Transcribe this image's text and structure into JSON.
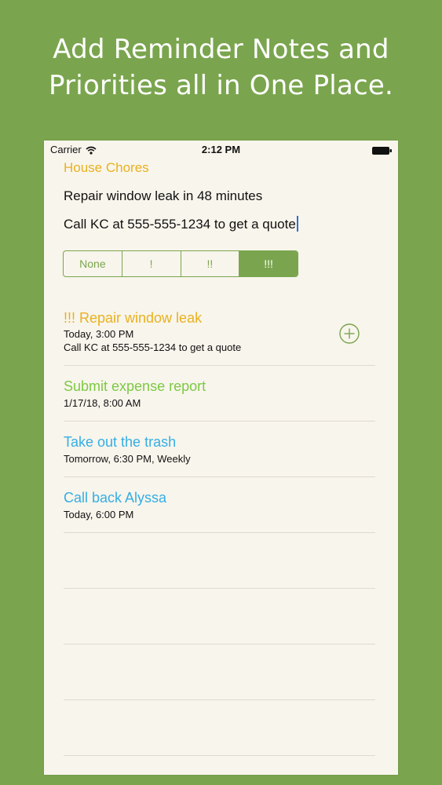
{
  "headline": {
    "line1": "Add Reminder Notes and",
    "line2": "Priorities all in One Place."
  },
  "status_bar": {
    "carrier": "Carrier",
    "time": "2:12 PM"
  },
  "list": {
    "title": "House Chores",
    "title_color": "#e9b11f"
  },
  "editor": {
    "title_value": "Repair window leak in 48 minutes",
    "notes_value": "Call KC at 555-555-1234 to get a quote"
  },
  "priority": {
    "options": [
      "None",
      "!",
      "!!",
      "!!!"
    ],
    "selected": "!!!",
    "accent": "#7aa54e"
  },
  "reminders": [
    {
      "title": "!!! Repair window leak",
      "subtitle": "Today, 3:00 PM",
      "note": "Call KC at 555-555-1234 to get a quote",
      "color": "#e9b11f"
    },
    {
      "title": "Submit expense report",
      "subtitle": "1/17/18, 8:00 AM",
      "color": "#7dc943"
    },
    {
      "title": "Take out the trash",
      "subtitle": "Tomorrow, 6:30 PM, Weekly",
      "color": "#35aee4"
    },
    {
      "title": "Call back Alyssa",
      "subtitle": "Today, 6:00 PM",
      "color": "#35aee4"
    }
  ],
  "icons": {
    "wifi": "wifi-icon",
    "battery": "battery-icon",
    "add": "plus-circle-icon"
  }
}
